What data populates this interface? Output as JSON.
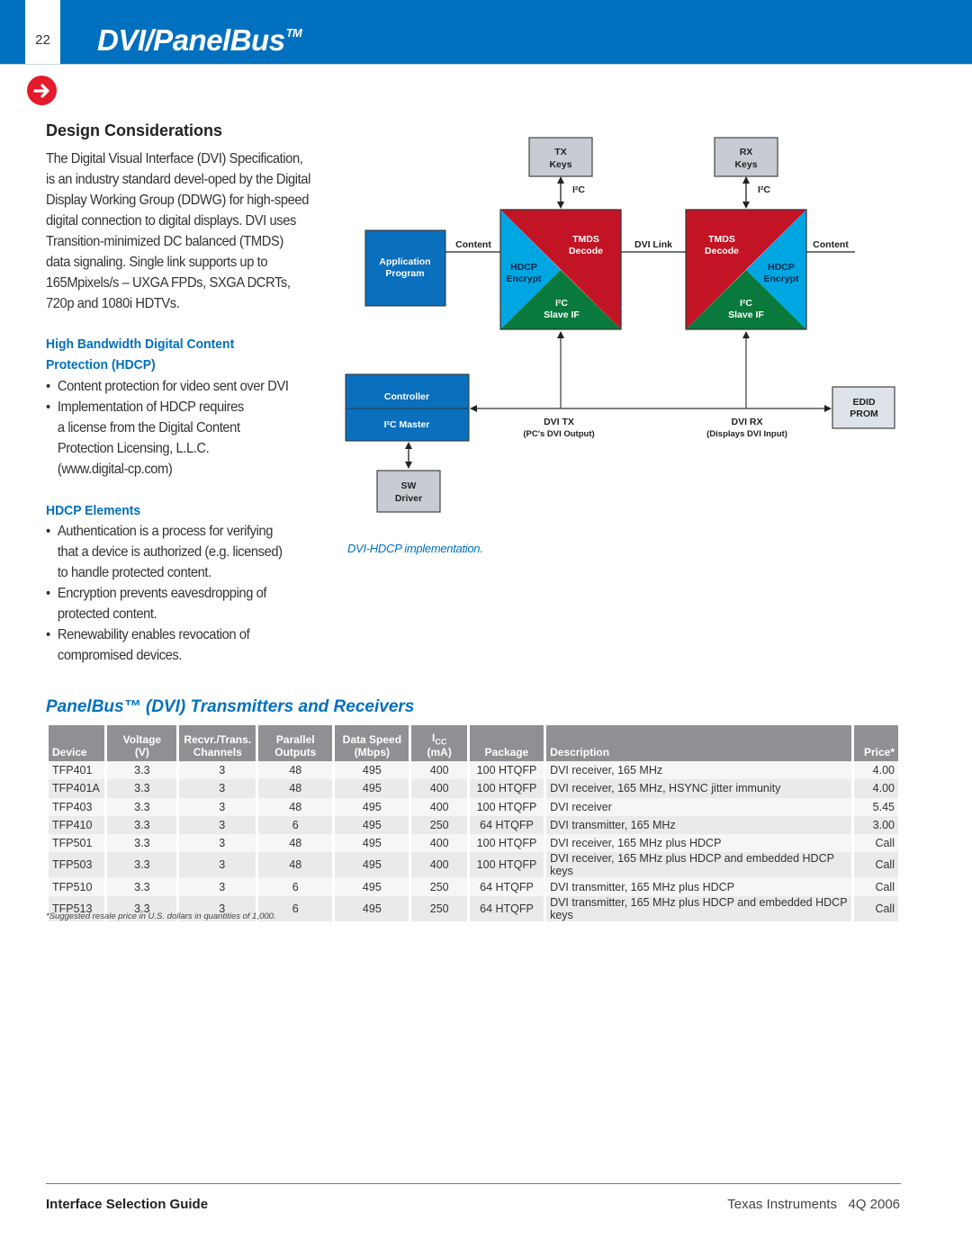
{
  "header": {
    "page_number": "22",
    "title": "DVI/PanelBus",
    "title_mark": "TM"
  },
  "design": {
    "title": "Design Considerations",
    "intro": "The Digital Visual Interface (DVI) Specification, is an industry standard devel-oped by the Digital Display Working Group (DDWG) for high-speed digital connection to digital displays.  DVI uses Transition-minimized DC balanced (TMDS) data signaling. Single link supports up to 165Mpixels/s – UXGA FPDs, SXGA DCRTs, 720p and 1080i HDTVs.",
    "hdcp_heading": "High Bandwidth Digital Content Protection (HDCP)",
    "hdcp_bullets": [
      "Content protection for video sent over DVI",
      "Implementation of HDCP requires a license from the Digital Content Protection Licensing, L.L.C. (www.digital-cp.com)"
    ],
    "elements_heading": "HDCP Elements",
    "elements_bullets": [
      "Authentication is a process for verifying that a device is authorized (e.g. licensed) to handle protected content.",
      "Encryption prevents eavesdropping of protected content.",
      "Renewability enables revocation of compromised devices."
    ]
  },
  "diagram": {
    "tx_keys": [
      "TX",
      "Keys"
    ],
    "rx_keys": [
      "RX",
      "Keys"
    ],
    "i2c": "I²C",
    "app_program": [
      "Application",
      "Program"
    ],
    "content_left": "Content",
    "content_right": "Content",
    "dvi_link": "DVI Link",
    "tmds": [
      "TMDS",
      "Decode"
    ],
    "hdcp": [
      "HDCP",
      "Encrypt"
    ],
    "slave": [
      "I²C",
      "Slave IF"
    ],
    "controller": "Controller",
    "i2c_master": "I²C Master",
    "sw_driver": [
      "SW",
      "Driver"
    ],
    "dvi_tx": [
      "DVI TX",
      "(PC's DVI Output)"
    ],
    "dvi_rx": [
      "DVI RX",
      "(Displays DVI Input)"
    ],
    "edid": [
      "EDID",
      "PROM"
    ],
    "caption": "DVI-HDCP implementation.",
    "colors": {
      "red": "#c31425",
      "cyan": "#00a6e2",
      "green": "#097a3c",
      "blue": "#0a6fbd",
      "gray": "#c8cbd1"
    }
  },
  "table": {
    "title": "PanelBus™ (DVI) Transmitters and Receivers",
    "headers": [
      [
        "",
        "Device"
      ],
      [
        "Voltage",
        "(V)"
      ],
      [
        "Recvr./Trans.",
        "Channels"
      ],
      [
        "Parallel",
        "Outputs"
      ],
      [
        "Data Speed",
        "(Mbps)"
      ],
      [
        "ICC",
        "(mA)"
      ],
      [
        "",
        "Package"
      ],
      [
        "",
        "Description"
      ],
      [
        "",
        "Price*"
      ]
    ],
    "rows": [
      [
        "TFP401",
        "3.3",
        "3",
        "48",
        "495",
        "400",
        "100 HTQFP",
        "DVI receiver, 165 MHz",
        "4.00"
      ],
      [
        "TFP401A",
        "3.3",
        "3",
        "48",
        "495",
        "400",
        "100 HTQFP",
        "DVI receiver, 165 MHz, HSYNC jitter immunity",
        "4.00"
      ],
      [
        "TFP403",
        "3.3",
        "3",
        "48",
        "495",
        "400",
        "100 HTQFP",
        "DVI receiver",
        "5.45"
      ],
      [
        "TFP410",
        "3.3",
        "3",
        "6",
        "495",
        "250",
        "64 HTQFP",
        "DVI transmitter, 165 MHz",
        "3.00"
      ],
      [
        "TFP501",
        "3.3",
        "3",
        "48",
        "495",
        "400",
        "100 HTQFP",
        "DVI receiver, 165 MHz plus HDCP",
        "Call"
      ],
      [
        "TFP503",
        "3.3",
        "3",
        "48",
        "495",
        "400",
        "100 HTQFP",
        "DVI receiver, 165 MHz plus HDCP and embedded HDCP keys",
        "Call"
      ],
      [
        "TFP510",
        "3.3",
        "3",
        "6",
        "495",
        "250",
        "64 HTQFP",
        "DVI transmitter, 165 MHz plus HDCP",
        "Call"
      ],
      [
        "TFP513",
        "3.3",
        "3",
        "6",
        "495",
        "250",
        "64 HTQFP",
        "DVI transmitter, 165 MHz plus HDCP and embedded HDCP keys",
        "Call"
      ]
    ],
    "footnote": "*Suggested resale price in U.S. dollars in quantities of 1,000."
  },
  "footer": {
    "left": "Interface Selection Guide",
    "right": "Texas Instruments   4Q 2006"
  }
}
